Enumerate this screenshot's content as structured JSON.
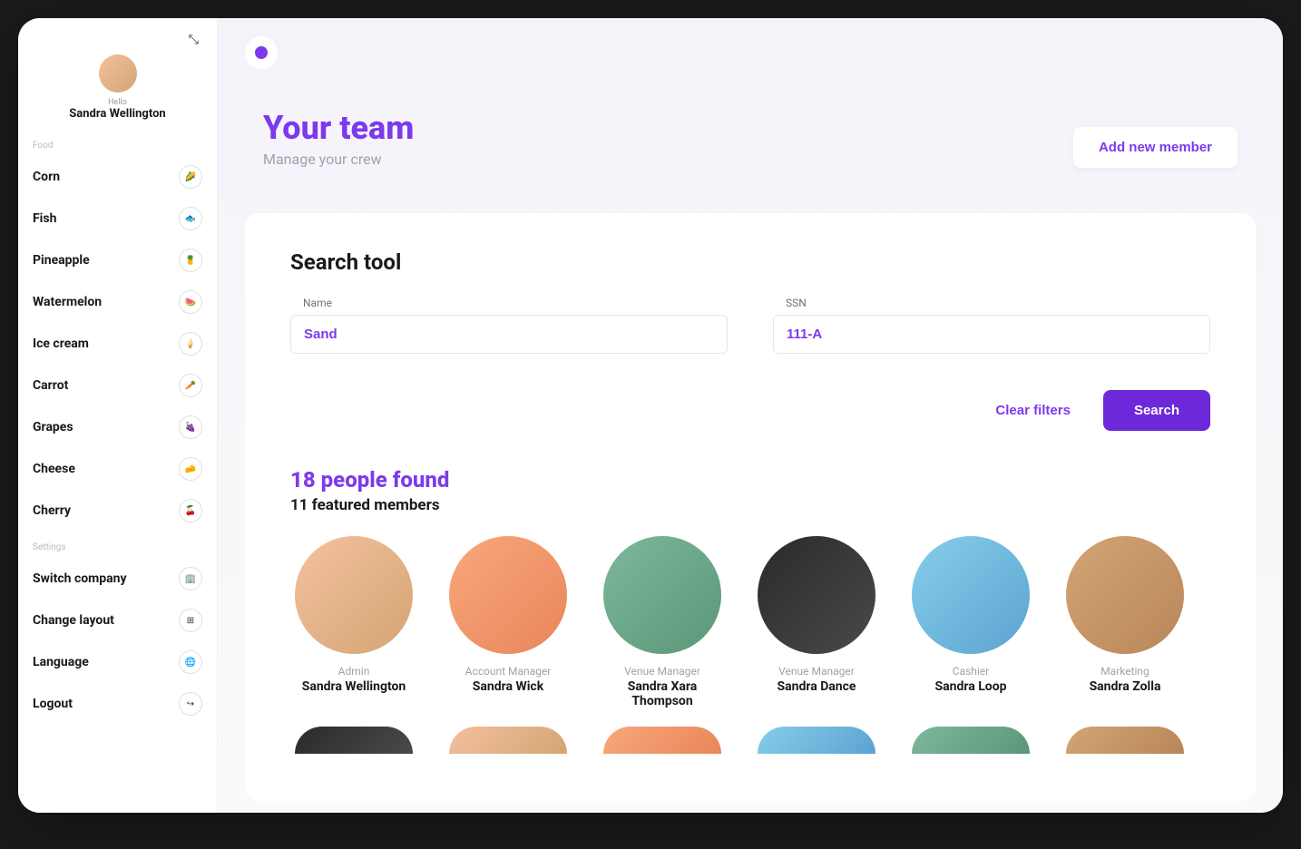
{
  "profile": {
    "hello": "Hello",
    "name": "Sandra Wellington"
  },
  "sidebar": {
    "section1_label": "Food",
    "food_items": [
      {
        "label": "Corn",
        "icon": "🌽"
      },
      {
        "label": "Fish",
        "icon": "🐟"
      },
      {
        "label": "Pineapple",
        "icon": "🍍"
      },
      {
        "label": "Watermelon",
        "icon": "🍉"
      },
      {
        "label": "Ice cream",
        "icon": "🍦"
      },
      {
        "label": "Carrot",
        "icon": "🥕"
      },
      {
        "label": "Grapes",
        "icon": "🍇"
      },
      {
        "label": "Cheese",
        "icon": "🧀"
      },
      {
        "label": "Cherry",
        "icon": "🍒"
      }
    ],
    "section2_label": "Settings",
    "settings_items": [
      {
        "label": "Switch company",
        "icon": "🏢"
      },
      {
        "label": "Change layout",
        "icon": "⊞"
      },
      {
        "label": "Language",
        "icon": "🌐"
      },
      {
        "label": "Logout",
        "icon": "↪"
      }
    ]
  },
  "header": {
    "title": "Your team",
    "subtitle": "Manage your crew",
    "add_button": "Add new member"
  },
  "search": {
    "title": "Search tool",
    "name_label": "Name",
    "name_value": "Sand",
    "ssn_label": "SSN",
    "ssn_value": "111-A",
    "clear_label": "Clear filters",
    "search_label": "Search"
  },
  "results": {
    "count_text": "18 people found",
    "featured_text": "11 featured members",
    "members": [
      {
        "role": "Admin",
        "name": "Sandra Wellington"
      },
      {
        "role": "Account Manager",
        "name": "Sandra Wick"
      },
      {
        "role": "Venue Manager",
        "name": "Sandra Xara Thompson"
      },
      {
        "role": "Venue Manager",
        "name": "Sandra Dance"
      },
      {
        "role": "Cashier",
        "name": "Sandra Loop"
      },
      {
        "role": "Marketing",
        "name": "Sandra Zolla"
      }
    ]
  }
}
